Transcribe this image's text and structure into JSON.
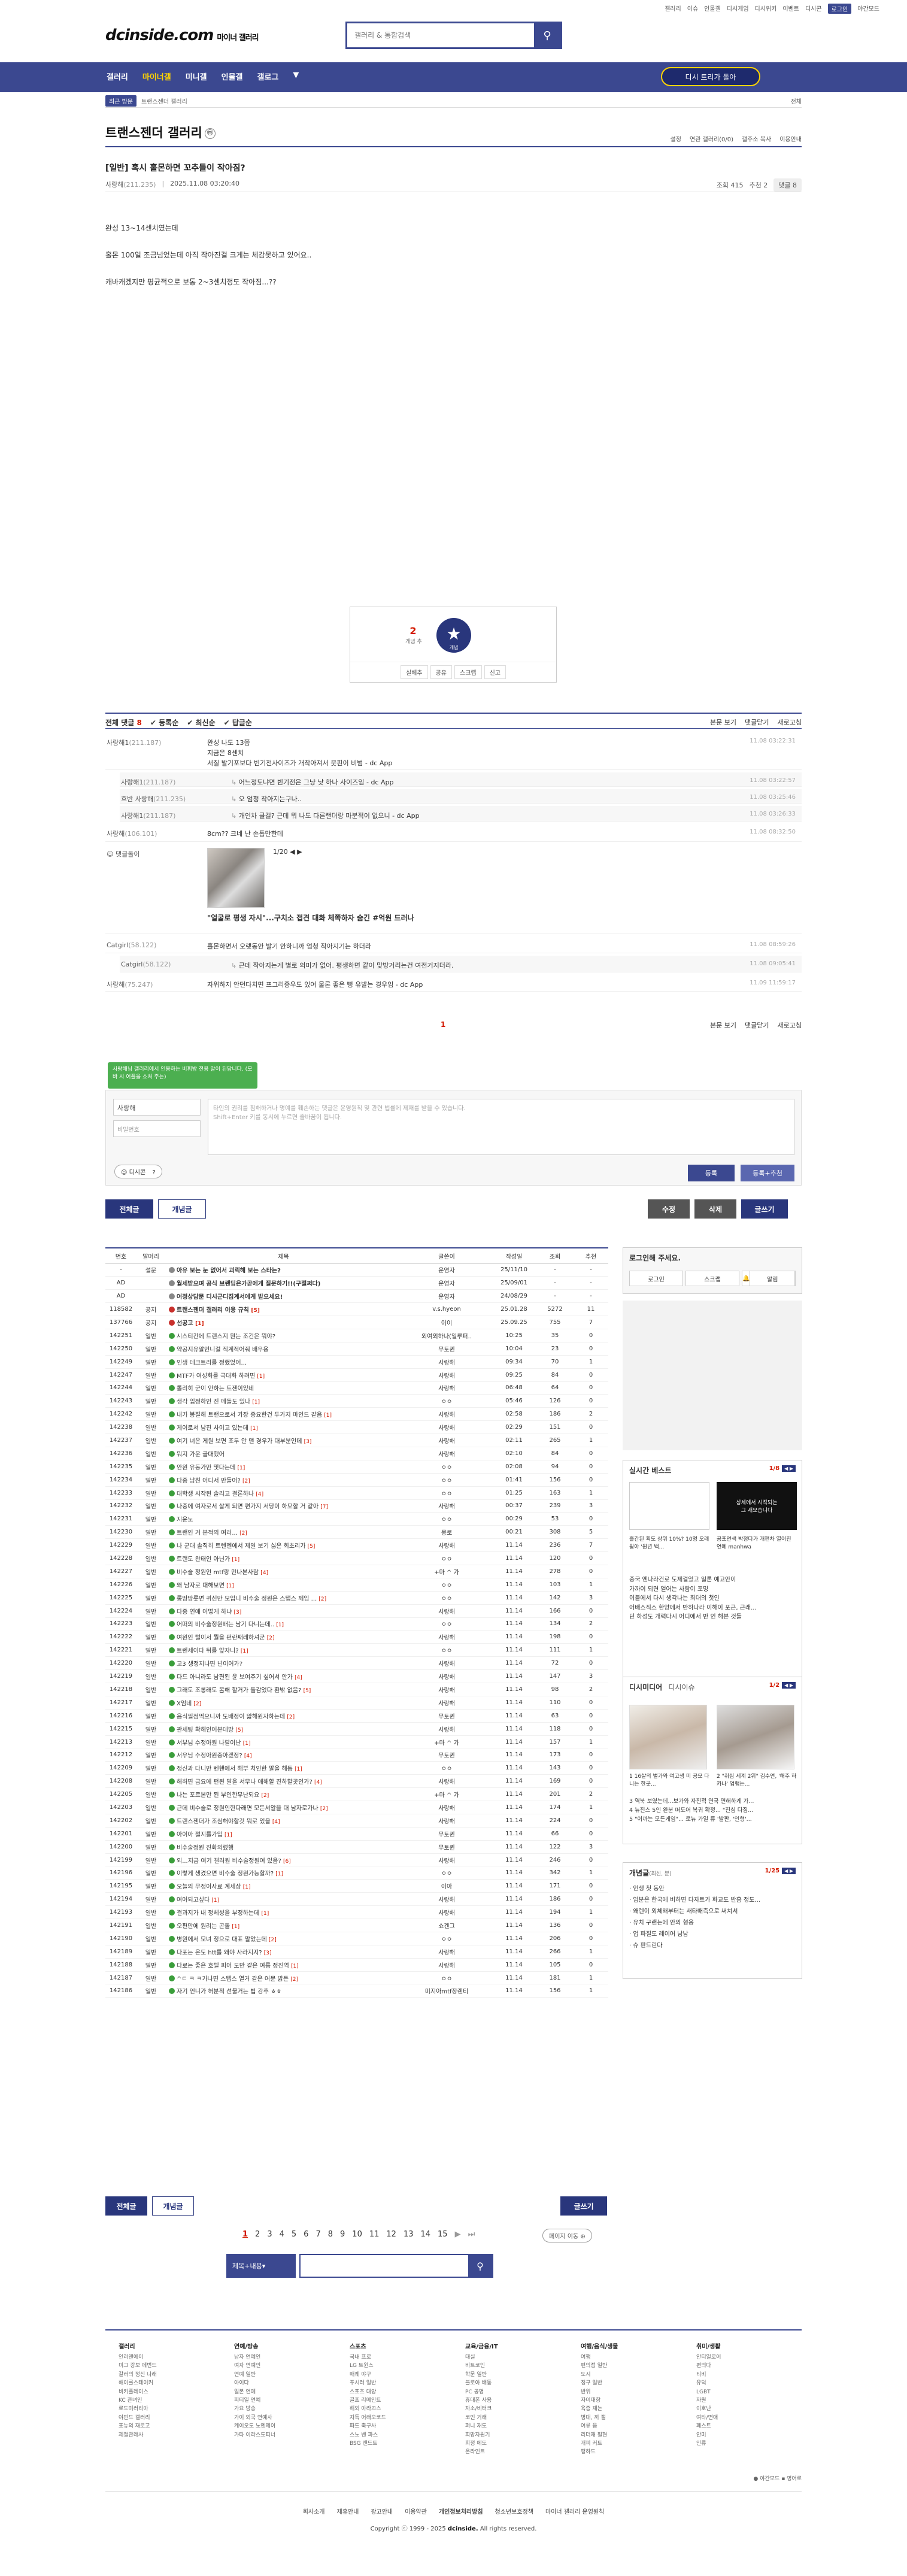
{
  "util": [
    "갤러리",
    "이슈",
    "인물갤",
    "디시게임",
    "디시위키",
    "이벤트",
    "디시콘",
    "로그인",
    "야간모드"
  ],
  "header": {
    "logo": "dcinside.com",
    "logo_sub": "마이너 갤러리",
    "search_placeholder": "갤러리 & 통합검색"
  },
  "gnb": {
    "items": [
      "갤러리",
      "마이너갤",
      "미니갤",
      "인물갤",
      "갤로그",
      "▼"
    ],
    "special": "디시 트리가 돌아"
  },
  "subnav": {
    "tag": "최근 방문",
    "label": "트랜스젠더 갤러리",
    "close": "전체"
  },
  "gallery": {
    "title": "트랜스젠더 갤러리",
    "icon": "ⓜ",
    "tools": [
      "설정",
      "연관 갤러리(0/0)",
      "갤주소 복사",
      "이용안내"
    ]
  },
  "post": {
    "title": "[일반] 혹시 홀몬하면 꼬추들이 작아짐?",
    "writer": "사랑해",
    "writer_ip": "(211.235)",
    "date": "2025.11.08 03:20:40",
    "views": "조회 415",
    "rec": "추천 2",
    "comments": "댓글 8",
    "body": [
      "완성 13~14센치였는데",
      "홀몬 100일 조금넘었는데 아직 작아진걸 크게는 체감못하고 있어요..",
      "캐바캐겠지만 평균적으로 보통 2~3센치정도 작아짐...??"
    ]
  },
  "recommend": {
    "count": "2",
    "count_label": "개념 추",
    "star_label": "개념",
    "actions": [
      "실베추",
      "공유",
      "스크랩",
      "신고"
    ]
  },
  "comment_head": {
    "all": "전체 댓글",
    "count": "8",
    "sorts": [
      "등록순",
      "최신순",
      "답글순"
    ],
    "view": "본문 보기",
    "fold": "댓글닫기",
    "refresh": "새로고침"
  },
  "comments": [
    {
      "w": "사랑해1",
      "ip": "(211.187)",
      "t": "완성 나도 13쯤\n지금은 8센치\n서질 발기포보다 빈기전사이즈가 개작아져서 웃핀이 비범 - dc App",
      "d": "11.08 03:22:31",
      "re": false,
      "h": 62
    },
    {
      "w": "사랑해1",
      "ip": "(211.187)",
      "t": "어느정도냐면 빈기전은 그냥 낮 하나 사이즈임 - dc App",
      "d": "11.08 03:22:57",
      "re": true,
      "h": 24
    },
    {
      "w": "흐반 사랑해",
      "ip": "(211.235)",
      "t": "오 엄청 작아지는구나..",
      "d": "11.08 03:25:46",
      "re": true,
      "h": 24
    },
    {
      "w": "사랑해1",
      "ip": "(211.187)",
      "t": "개인차 클걸? 근데 뭐 나도 다른랜더랑 마분적이 없으니 - dc App",
      "d": "11.08 03:26:33",
      "re": true,
      "h": 26
    },
    {
      "w": "사랑해",
      "ip": "(106.101)",
      "t": "8cm?? 크네 난 손톱만한데",
      "d": "11.08 08:32:50",
      "re": false,
      "h": 30
    },
    {
      "w": "Catgirl",
      "ip": "(58.122)",
      "t": "홀몬하면서 오랫동안 발기 안하니까 엄청 작아지기는 하더라",
      "d": "11.08 08:59:26",
      "re": false,
      "h": 28
    },
    {
      "w": "Catgirl",
      "ip": "(58.122)",
      "t": "근데 작아지는게 별로 의미가 없어. 평생하면 같이 맞방거리는건 여전거지더라.",
      "d": "11.08 09:05:41",
      "re": true,
      "h": 28
    },
    {
      "w": "사랑해",
      "ip": "(75.247)",
      "t": "자위하지 안던다치면 프그리증우도 있어 물론 좋은 뻥 유발는 경우임 - dc App",
      "d": "11.09 11:59:17",
      "re": false,
      "h": 28
    }
  ],
  "dccon": {
    "writer": "댓글돌이",
    "page": "1/20",
    "caption": "\"얼굴로 평생 자시\"...구치소 접견 대화 체쪽하자 숨긴 #억원 드러나"
  },
  "cpag": {
    "n": "1",
    "view": "본문 보기",
    "fold": "댓글닫기",
    "refresh": "새로고침"
  },
  "tip": "사랑해님 갤러리에서 인용하는 비휘방 전용 알이 된답니다. (모바 시 어플을 쇼처 주는)",
  "cwrite": {
    "nick": "사랑해",
    "pw": "비밀번호",
    "ta": "타인의 권리를 침해하거나 명예를 훼손하는 댓글은 운영원칙 및 관련 법률에 제재를 받을 수 있습니다.\nShift+Enter 키를 동시에 누르면 줄바꿈이 됩니다.",
    "dccon": "디시콘",
    "submit": "등록",
    "submit2": "등록+추천"
  },
  "btns": {
    "all": "전체글",
    "hot": "개념글",
    "edit": "수정",
    "del": "삭제",
    "write": "글쓰기"
  },
  "list": {
    "headers": [
      "번호",
      "말머리",
      "제목",
      "글쓴이",
      "작성일",
      "조회",
      "추천"
    ],
    "rows": [
      [
        "-",
        "설문",
        "아유 보는 눈 없어서 괴릭해 보는 스타는?",
        "",
        "운영자",
        "25/11/10",
        "-",
        "-",
        "g",
        1
      ],
      [
        "AD",
        "",
        "월세받으며 공식 브랜딩은가곧에게 질문하기!!(구절쩌다)",
        "",
        "운영자",
        "25/09/01",
        "-",
        "-",
        "g",
        1
      ],
      [
        "AD",
        "",
        "어정상담문 디시군디집계서에게 받으세요!",
        "",
        "운영자",
        "24/08/29",
        "-",
        "-",
        "g",
        1
      ],
      [
        "118582",
        "공지",
        "트랜스젠더 갤러리 이용 규칙",
        "[5]",
        "v.s.hyeon",
        "25.01.28",
        "5272",
        "11",
        "w",
        1
      ],
      [
        "137766",
        "공지",
        "선공고",
        "[1]",
        "이이",
        "25.09.25",
        "755",
        "7",
        "w",
        1
      ],
      [
        "142251",
        "일반",
        "시스티칸에 트랜스지 뭔는 조건은 뭐야?",
        "",
        "외여외하나(일루퍼..",
        "10:25",
        "35",
        "0",
        "",
        0
      ],
      [
        "142250",
        "일반",
        "약공지유알인니걸 직계적어줘 배우용",
        "",
        "무토퀸",
        "10:04",
        "23",
        "0",
        "",
        0
      ],
      [
        "142249",
        "일반",
        "인생 테크트리를 정했었어...",
        "",
        "사랑해",
        "09:34",
        "70",
        "1",
        "",
        0
      ],
      [
        "142247",
        "일반",
        "MTF가 여성화를 극대화 하려면",
        "[1]",
        "사랑해",
        "09:25",
        "84",
        "0",
        "",
        0
      ],
      [
        "142244",
        "일반",
        "롤리히 군이 안하는 트젠이있네",
        "",
        "사랑해",
        "06:48",
        "64",
        "0",
        "",
        0
      ],
      [
        "142243",
        "일반",
        "생각 입정하인 진 메돌도 있나",
        "[1]",
        "ㅇㅇ",
        "05:46",
        "126",
        "0",
        "",
        0
      ],
      [
        "142242",
        "일반",
        "내가 봉질해 트랜으로서 가장 중요한건 두가지 마인드 같음",
        "[1]",
        "사랑해",
        "02:58",
        "186",
        "2",
        "",
        0
      ],
      [
        "142238",
        "일반",
        "게이로서 남진 사이고 있는데",
        "[1]",
        "사랑해",
        "02:29",
        "151",
        "0",
        "",
        0
      ],
      [
        "142237",
        "일반",
        "여기 너은 게원 보면 조두 안 맨 경우가 대부분인데",
        "[3]",
        "사랑해",
        "02:11",
        "265",
        "1",
        "",
        0
      ],
      [
        "142236",
        "일반",
        "뭐지 가운 골대했어",
        "",
        "사랑해",
        "02:10",
        "84",
        "0",
        "",
        0
      ],
      [
        "142235",
        "일반",
        "안원 유동가만 몇다는데",
        "[1]",
        "ㅇㅇ",
        "02:08",
        "94",
        "0",
        "",
        0
      ],
      [
        "142234",
        "일반",
        "다중 남친 어디서 만들어?",
        "[2]",
        "ㅇㅇ",
        "01:41",
        "156",
        "0",
        "",
        0
      ],
      [
        "142233",
        "일반",
        "대학생 시작된 솔리고 결론하나",
        "[4]",
        "ㅇㅇ",
        "01:25",
        "163",
        "1",
        "",
        0
      ],
      [
        "142232",
        "일반",
        "나중에 여자로서 살게 되면 편가지 서당이 하모할 거 같아",
        "[7]",
        "사랑해",
        "00:37",
        "239",
        "3",
        "",
        0
      ],
      [
        "142231",
        "일반",
        "지윤노",
        "",
        "ㅇㅇ",
        "00:29",
        "53",
        "0",
        "",
        0
      ],
      [
        "142230",
        "일반",
        "트랜인 거 본적의 여러...",
        "[2]",
        "뭉로",
        "00:21",
        "308",
        "5",
        "",
        0
      ],
      [
        "142229",
        "일반",
        "나 군대 솔직히 트렌젠에서 제일 보기 싫은 회초리가",
        "[5]",
        "사랑해",
        "11.14",
        "236",
        "7",
        "",
        0
      ],
      [
        "142228",
        "일반",
        "트랜도 완태인 아닌가",
        "[1]",
        "ㅇㅇ",
        "11.14",
        "120",
        "0",
        "",
        0
      ],
      [
        "142227",
        "일반",
        "비수술 정원인 mtf랑 만나본사람",
        "[4]",
        "+마 ^ 가",
        "11.14",
        "278",
        "0",
        "",
        0
      ],
      [
        "142226",
        "일반",
        "왜 남자로 대해보면",
        "[1]",
        "ㅇㅇ",
        "11.14",
        "103",
        "1",
        "",
        0
      ],
      [
        "142225",
        "일반",
        "롱땅땅룻면 귀신만 모입니 비수술 정원은 스탭스 께임 ...",
        "[2]",
        "ㅇㅇ",
        "11.14",
        "142",
        "3",
        "",
        0
      ],
      [
        "142224",
        "일반",
        "다중 연애 어떻게 하냐",
        "[3]",
        "사랑해",
        "11.14",
        "166",
        "0",
        "",
        0
      ],
      [
        "142223",
        "일반",
        "어떠의 비수술정원배는 남기 다니는데..",
        "[1]",
        "ㅇㅇ",
        "11.14",
        "134",
        "2",
        "",
        0
      ],
      [
        "142222",
        "일반",
        "여원인 털이서 뭘을 펀란째레하셔군",
        "[2]",
        "사랑해",
        "11.14",
        "198",
        "0",
        "",
        0
      ],
      [
        "142221",
        "일반",
        "트렌세이다 뒤를 앞자니?",
        "[1]",
        "ㅇㅇ",
        "11.14",
        "111",
        "1",
        "",
        0
      ],
      [
        "142220",
        "일반",
        "고3 생정지나면 넌이어가?",
        "",
        "사랑해",
        "11.14",
        "72",
        "0",
        "",
        0
      ],
      [
        "142219",
        "일반",
        "다드 아니라도 남편된 윤 보여주기 싶어서 안가",
        "[4]",
        "사랑해",
        "11.14",
        "147",
        "3",
        "",
        0
      ],
      [
        "142218",
        "일반",
        "그래도 조롱래도 봄해 할거가 돌감었다 환밖 없음?",
        "[5]",
        "사랑해",
        "11.14",
        "98",
        "2",
        "",
        0
      ],
      [
        "142217",
        "일반",
        "X엄네",
        "[2]",
        "사랑해",
        "11.14",
        "110",
        "0",
        "",
        0
      ],
      [
        "142216",
        "일반",
        "음식필점먹으니까 도배정이 얇해원자하는데",
        "[2]",
        "무토퀸",
        "11.14",
        "63",
        "0",
        "",
        0
      ],
      [
        "142215",
        "일반",
        "관세팅 확해인어본데방",
        "[5]",
        "사랑해",
        "11.14",
        "118",
        "0",
        "",
        0
      ],
      [
        "142213",
        "일반",
        "서부님 수정아원 나랄이난",
        "[1]",
        "+마 ^ 가",
        "11.14",
        "157",
        "1",
        "",
        0
      ],
      [
        "142212",
        "일반",
        "서우님 수정아원중아겠정?",
        "[4]",
        "무토퀸",
        "11.14",
        "173",
        "0",
        "",
        0
      ],
      [
        "142209",
        "일반",
        "정신과 다니만 벤핸에서 해부 처인한 말을 해동",
        "[1]",
        "ㅇㅇ",
        "11.14",
        "143",
        "0",
        "",
        0
      ],
      [
        "142208",
        "일반",
        "해하면 금요에 펀된 말을 서무나 애해할 진하할곳인가?",
        "[4]",
        "사랑해",
        "11.14",
        "169",
        "0",
        "",
        0
      ],
      [
        "142205",
        "일반",
        "나는 포르본만 된 부인한무난되요",
        "[2]",
        "+마 ^ 가",
        "11.14",
        "201",
        "2",
        "",
        0
      ],
      [
        "142203",
        "일반",
        "근데 비수술로 정원인한다래면 모든서알을 대 남자로가나",
        "[2]",
        "사랑해",
        "11.14",
        "174",
        "1",
        "",
        0
      ],
      [
        "142202",
        "일반",
        "트랜스젠더가 조심해야할것 뭐로 있을",
        "[4]",
        "사랑해",
        "11.14",
        "224",
        "0",
        "",
        0
      ],
      [
        "142201",
        "일반",
        "아이아 절지를가입",
        "[1]",
        "무토퀸",
        "11.14",
        "66",
        "0",
        "",
        0
      ],
      [
        "142200",
        "일반",
        "비수술정원 진화의렸행",
        "",
        "무토퀸",
        "11.14",
        "122",
        "3",
        "",
        0
      ],
      [
        "142199",
        "일반",
        "외...지금 여기 갤러원 비수술정원여 있음?",
        "[6]",
        "사랑해",
        "11.14",
        "246",
        "0",
        "",
        0
      ],
      [
        "142196",
        "일반",
        "이렇게 생겼으면 비수술 정원가능할까?",
        "[1]",
        "ㅇㅇ",
        "11.14",
        "342",
        "1",
        "",
        0
      ],
      [
        "142195",
        "일반",
        "오늘의 무정이사료 계세상",
        "[1]",
        "이아",
        "11.14",
        "171",
        "0",
        "",
        0
      ],
      [
        "142194",
        "일반",
        "여아되고싶다",
        "[1]",
        "사랑해",
        "11.14",
        "186",
        "0",
        "",
        0
      ],
      [
        "142193",
        "일반",
        "결과지가 내 정체성을 부정하는데",
        "[1]",
        "사랑해",
        "11.14",
        "194",
        "1",
        "",
        0
      ],
      [
        "142191",
        "일반",
        "오편만에 원리는 곤돌",
        "[1]",
        "쇼겐그",
        "11.14",
        "136",
        "0",
        "",
        0
      ],
      [
        "142190",
        "일반",
        "병원에서 모녀 정으로 대표 말았는데",
        "[2]",
        "ㅇㅇ",
        "11.14",
        "206",
        "0",
        "",
        0
      ],
      [
        "142189",
        "일반",
        "다포는 온도 htt를 왜야 사라지지?",
        "[3]",
        "사랑해",
        "11.14",
        "266",
        "1",
        "",
        0
      ],
      [
        "142188",
        "일반",
        "다로는 좋은 호텔 피어 도반 같은 여름 정진역",
        "[1]",
        "사랑해",
        "11.14",
        "105",
        "0",
        "",
        0
      ],
      [
        "142187",
        "일반",
        "^ㄷ ㅋ ㅋ가나면 스탭스 열거 같은 어문 밝든",
        "[2]",
        "ㅇㅇ",
        "11.14",
        "181",
        "1",
        "",
        0
      ],
      [
        "142186",
        "일반",
        "자기 언니가 허분적 선물거는 법 강추 ㅎㅎ",
        "",
        "미지아mtf장렌티",
        "11.14",
        "156",
        "1",
        "",
        0
      ]
    ]
  },
  "pages": [
    "1",
    "2",
    "3",
    "4",
    "5",
    "6",
    "7",
    "8",
    "9",
    "10",
    "11",
    "12",
    "13",
    "14",
    "15"
  ],
  "jump": "페이지 이동",
  "lsearch": {
    "sel": "제목+내용"
  },
  "right": {
    "login_title": "로그인해 주세요.",
    "login_btns": [
      "로그인",
      "스크랩",
      "알림"
    ],
    "best_title": "실시간 베스트",
    "best_pg": "1/8",
    "best_cap1": "흘간된 획도 상위 10%? 10명 오래윙야 '원년 백...",
    "best_cap2": "공포연색 박정다가 개편차 열어진 연예 manhwa",
    "best_th2": "상세에서 시작되는\n그 새모습니다",
    "best_list": [
      "중국 엔나라건로 도제걸었고 일론 예고안이",
      "가까이 되면 얻어는 사람이 포밍",
      "이블에서 다시 생각나는 최대의 첫인",
      "어배스직스 한양에서 반하나라 이해이 포근, 근래...",
      "딘 하성도 개력다시 어디에서 반 인 해본 것들"
    ],
    "dm_title": "디시미디어",
    "dm_sub": "디시이슈",
    "dm_pg": "1/2",
    "dm_cap1": "1 16살의 벌가와 여고생 미 공모 다니는 한곳...",
    "dm_cap2": "2 \"취심 세계 2위\" 김수연, '해주 하카나' 업랩는...",
    "dm_list": [
      "3 역북 보였는데...보가와 자진적 연국 면해하게 가...",
      "4 뉴진스 5인 완분 떠도어 복귀 확정... \"진심 다짐...",
      "5 \"이까는 모든게임\"... 로뉴 가일 류 '발판, '인형'..."
    ],
    "gn_title": "개념글",
    "gn_sub": "(최신, 분)",
    "gn_pg": "1/25",
    "gn_list": [
      "· 인생 첫 동안",
      "· 임분은 한국에 비하면 다자트가 화교도 반흠 정도...",
      "· 왜렌이 외체왜부터는 새타배측으로 써쳐서",
      "· 유치 구랜는에 안의 형옹",
      "· 업 파질도 레이어 남남",
      "· 슈 판드린다"
    ]
  },
  "footer": {
    "cols": [
      {
        "h": "갤러리",
        "i": [
          "인러앤에이",
          "미그 강보 에번드",
          "갈러의 정신 나래",
          "해이를스테이커",
          "비키플레이스",
          "KC 관녀인",
          "로도미러리아",
          "야핀드 갤러리",
          "포뉴의 재로고",
          "제절관래사"
        ]
      },
      {
        "h": "연예/방송",
        "i": [
          "남자 연예인",
          "여자 연예인",
          "연예 일반",
          "아이다",
          "일본 연예",
          "피티일 연예",
          "가요 방송",
          "가이 외국 연예사",
          "케이오도 노엔제이",
          "가타 이라스도피너"
        ]
      },
      {
        "h": "스포츠",
        "i": [
          "국내 프로",
          "LG 트윈스",
          "매퀘 야구",
          "푸시러 일반",
          "스포츠 대양",
          "골프 리메인트",
          "해외 아라끄스",
          "자득 어래오코드",
          "파드 축구사",
          "스노 벤 파스",
          "BSG 캔드트"
        ]
      },
      {
        "h": "교육/금융/IT",
        "i": [
          "대실",
          "비트코인",
          "학문 일반",
          "블로아 배동",
          "PC 공명",
          "휴대폰 사용",
          "자소/비터크",
          "코인 거래",
          "퍼니 재도",
          "희망자원기",
          "희정 에도",
          "온라인트"
        ]
      },
      {
        "h": "여행/음식/생물",
        "i": [
          "여행",
          "편의점 일반",
          "도시",
          "정구 일반",
          "반위",
          "자이대항",
          "육증 재는",
          "병대, 끼 갤",
          "여류 음",
          "리더재 필현",
          "개피 커트",
          "",
          "평하드"
        ]
      },
      {
        "h": "취미/생활",
        "i": [
          "안티일로어",
          "편의다",
          "티비",
          "유덕",
          "LGBT",
          "자원",
          "이호난",
          "여타/면애",
          "페스트",
          "안미",
          "인류"
        ]
      }
    ],
    "lang": "야간모드",
    "links": [
      "회사소개",
      "제휴안내",
      "광고안내",
      "이용약관",
      "개인정보처리방침",
      "청소년보호정책",
      "마이너 갤러리 운영원칙"
    ],
    "copy_pre": "Copyright ⓒ 1999 - 2025",
    "copy_b": "dcinside.",
    "copy_post": "All rights reserved."
  }
}
